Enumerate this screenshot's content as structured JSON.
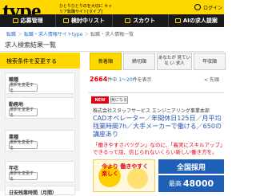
{
  "header": {
    "logo": "type",
    "tagline": "ひとりひとりのを大切に キャリア転職サイト[タイプ]",
    "user_label": "ログイン"
  },
  "nav": [
    {
      "label": "応募管理"
    },
    {
      "label": "検討中リスト"
    },
    {
      "label": "スカウト"
    },
    {
      "label": "AIの求人提案"
    }
  ],
  "breadcrumb": {
    "home": "転職",
    "parent": "転職・求人情報サイトtype",
    "current": "転職・求人情報一覧"
  },
  "page_title": "求人検索結果一覧",
  "sidebar": {
    "header": "検索条件を変更する",
    "filters": [
      {
        "title": "職種",
        "button": "選択を変更する"
      },
      {
        "title": "勤務地",
        "button": "選択を変更する"
      },
      {
        "title": "業種",
        "button": "選択を変更する"
      },
      {
        "title": "年収",
        "button": "選択を変更する"
      },
      {
        "title": "日安残業時間（月間）",
        "button": ""
      }
    ]
  },
  "tabs": [
    {
      "label": "新着順",
      "active": true
    },
    {
      "label": "締切順",
      "active": false
    },
    {
      "label": "あなたが 見ていな い 求人",
      "active": false
    },
    {
      "label": "年収順",
      "active": false
    }
  ],
  "results": {
    "count": "2664",
    "unit": "件中",
    "range": "1〜20",
    "range_suffix": "件を表示",
    "sort": "< 先頭"
  },
  "job": {
    "new_label": "NEW",
    "check_label": "気になる",
    "company": "株式会社スタッフサービス エンジニアリング事業本部",
    "title": "CADオペレーター／年間休日125日／月平均残業時間7h／大手メーカーで働ける／650の講座あり",
    "catch": "「働きやすさバツグン」なのに、「着実にスキルアップ」できるって話、信じられないくらい新しい働き方を。",
    "image_text": "今より 働きやすく 楽しく",
    "badge1": "全国採用",
    "badge2_prefix": "最高",
    "badge2_value": "48000",
    "colors": {
      "brand": "#FFD800",
      "accent": "#e60012",
      "link": "#2a55b3"
    }
  }
}
